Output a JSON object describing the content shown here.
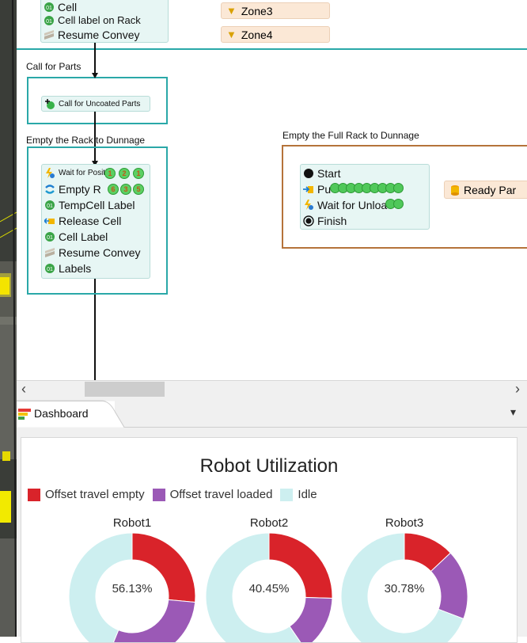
{
  "flow": {
    "top_panel": {
      "rows": [
        "Cell",
        "Cell label on Rack",
        "Resume Convey"
      ]
    },
    "zones": [
      "Zone3",
      "Zone4"
    ],
    "call_for_parts": {
      "label": "Call for Parts",
      "item": "Call for Uncoated Parts"
    },
    "empty_rack": {
      "label": "Empty the Rack to Dunnage",
      "rows": [
        "Wait for Positi",
        "Empty R",
        "TempCell Label",
        "Release Cell",
        "Cell Label",
        "Resume Convey",
        "Labels"
      ],
      "wait_badges": [
        "1",
        "2",
        "1"
      ],
      "empty_badges": [
        "6",
        "3",
        "5"
      ]
    },
    "full_rack": {
      "label": "Empty the Full Rack to Dunnage",
      "rows": [
        "Start",
        "Pu",
        "Wait for Unloa",
        "Finish"
      ],
      "side_item": "Ready Par"
    }
  },
  "scrollbar": {
    "left_arrow": "‹",
    "right_arrow": "›"
  },
  "dashboard": {
    "tab_label": "Dashboard",
    "dropdown_glyph": "▾",
    "chart_data": {
      "type": "pie",
      "title": "Robot Utilization",
      "legend": [
        {
          "name": "Offset travel empty",
          "color": "#d9232a"
        },
        {
          "name": "Offset travel loaded",
          "color": "#9b59b6"
        },
        {
          "name": "Idle",
          "color": "#cdeff0"
        }
      ],
      "charts": [
        {
          "name": "Robot1",
          "center_label": "56.13%",
          "values": [
            26.5,
            29.63,
            43.87
          ]
        },
        {
          "name": "Robot2",
          "center_label": "40.45%",
          "values": [
            25.5,
            14.95,
            59.55
          ]
        },
        {
          "name": "Robot3",
          "center_label": "30.78%",
          "values": [
            13.0,
            17.78,
            69.22
          ]
        }
      ]
    }
  }
}
